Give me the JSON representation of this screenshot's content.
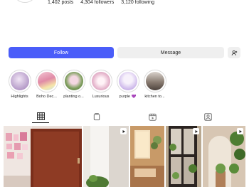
{
  "profile": {
    "stats": {
      "posts": "1,402 posts",
      "followers": "4,304 followers",
      "following": "3,120 following"
    }
  },
  "actions": {
    "follow_label": "Follow",
    "message_label": "Message",
    "suggest_icon": "person-add-icon"
  },
  "highlights": [
    {
      "label": "Highlights",
      "color": "#d8c6e4"
    },
    {
      "label": "Boho Dec...",
      "color": "#e6b7c6"
    },
    {
      "label": "planting o...",
      "color": "#9fb585"
    },
    {
      "label": "Luxurious",
      "color": "#e9c8d8"
    },
    {
      "label": "purple 💜",
      "color": "#d8c7ef"
    },
    {
      "label": "kitchen to...",
      "color": "#8a7b72"
    }
  ],
  "tabs": [
    {
      "name": "grid-icon",
      "active": true
    },
    {
      "name": "reels-icon",
      "active": false
    },
    {
      "name": "video-icon",
      "active": false
    },
    {
      "name": "tagged-icon",
      "active": false
    }
  ],
  "posts": [
    {
      "is_reel": false,
      "color": "#e6d2c6"
    },
    {
      "is_reel": true,
      "color": "#8a3a22"
    },
    {
      "is_reel": true,
      "color": "#ece9e4"
    },
    {
      "is_reel": false,
      "color": "#c99d6c"
    },
    {
      "is_reel": true,
      "color": "#6f5b4a"
    },
    {
      "is_reel": true,
      "color": "#b8a089"
    }
  ]
}
